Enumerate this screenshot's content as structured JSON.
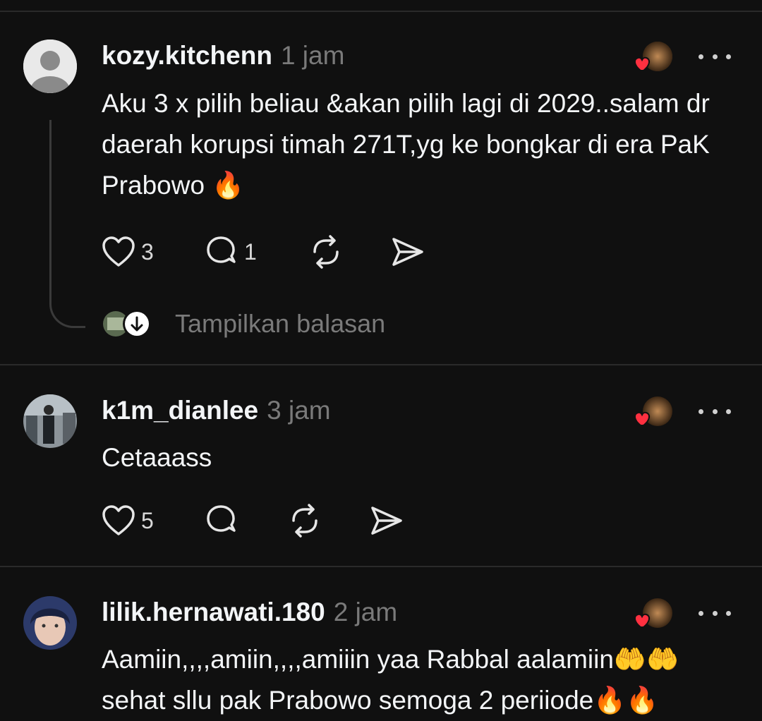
{
  "comments": [
    {
      "username": "kozy.kitchenn",
      "time": "1 jam",
      "text": "Aku 3 x pilih beliau &akan pilih lagi di 2029..salam dr daerah korupsi timah 271T,yg ke bongkar di era PaK Prabowo 🔥",
      "likes": "3",
      "replies": "1"
    },
    {
      "username": "k1m_dianlee",
      "time": "3 jam",
      "text": "Cetaaass",
      "likes": "5",
      "replies": ""
    },
    {
      "username": "lilik.hernawati.180",
      "time": "2 jam",
      "text": "Aamiin,,,,amiin,,,,amiiin yaa Rabbal aalamiin🤲🤲 sehat sllu pak Prabowo semoga 2 periiode🔥🔥",
      "likes": "",
      "replies": ""
    }
  ],
  "show_replies_label": "Tampilkan balasan",
  "colors": {
    "background": "#101010",
    "text": "#f3f5f7",
    "muted": "#7a7a7a",
    "heart": "#ff3040"
  }
}
